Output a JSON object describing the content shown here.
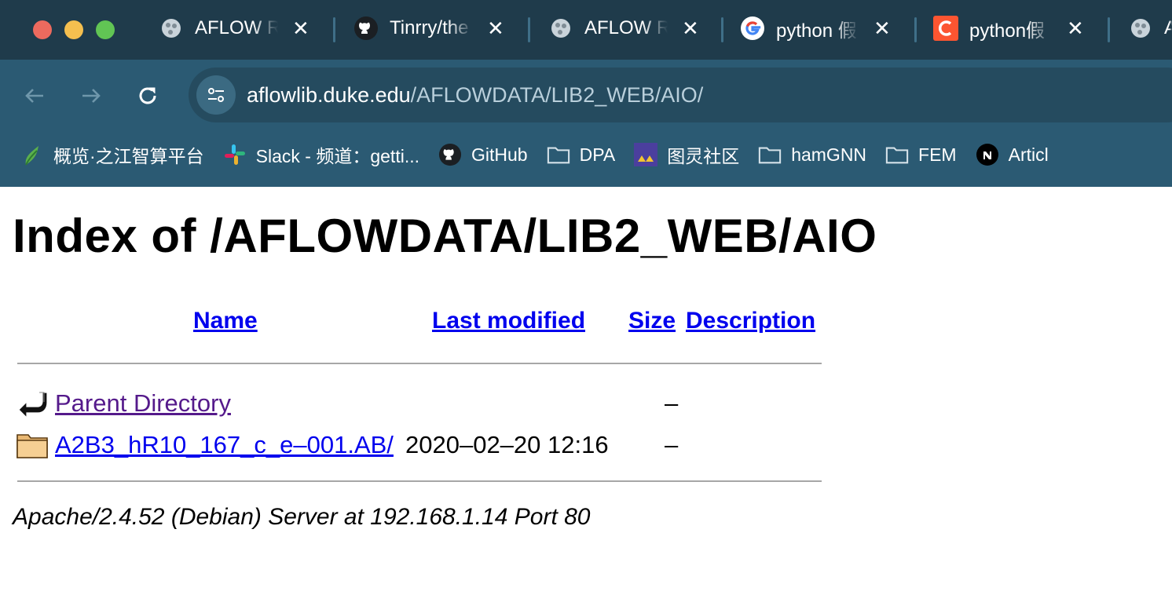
{
  "browser": {
    "tabs": [
      {
        "title": "AFLOW R",
        "icon": "aflow-icon"
      },
      {
        "title": "Tinrry/the",
        "icon": "github-icon"
      },
      {
        "title": "AFLOW R",
        "icon": "aflow-icon"
      },
      {
        "title": "python 假",
        "icon": "google-icon"
      },
      {
        "title": "python假",
        "icon": "csdn-icon"
      },
      {
        "title": "A",
        "icon": "aflow-icon"
      }
    ],
    "close_glyph": "✕",
    "url_host": "aflowlib.duke.edu",
    "url_path": "/AFLOWDATA/LIB2_WEB/AIO/",
    "bookmarks": [
      {
        "label": "概览·之江智算平台",
        "icon": "zhijiang-icon"
      },
      {
        "label": "Slack - 频道：getti...",
        "icon": "slack-icon"
      },
      {
        "label": "GitHub",
        "icon": "github-icon"
      },
      {
        "label": "DPA",
        "icon": "folder-icon"
      },
      {
        "label": "图灵社区",
        "icon": "turing-icon"
      },
      {
        "label": "hamGNN",
        "icon": "folder-icon"
      },
      {
        "label": "FEM",
        "icon": "folder-icon"
      },
      {
        "label": "Articl",
        "icon": "notion-icon"
      }
    ]
  },
  "page": {
    "heading": "Index of /AFLOWDATA/LIB2_WEB/AIO",
    "columns": {
      "name": "Name",
      "last_modified": "Last modified",
      "size": "Size",
      "description": "Description"
    },
    "rows": [
      {
        "name": "Parent Directory",
        "date": "",
        "size": "–",
        "icon": "back-arrow-icon"
      },
      {
        "name": "A2B3_hR10_167_c_e–001.AB/",
        "date": "2020–02–20 12:16",
        "size": "–",
        "icon": "folder-icon"
      }
    ],
    "footer": "Apache/2.4.52 (Debian) Server at 192.168.1.14 Port 80"
  },
  "colors": {
    "tabstrip": "#1f3b4b",
    "toolbar": "#2b5a73",
    "link": "#0000ee",
    "visited_link": "#551a8b"
  }
}
